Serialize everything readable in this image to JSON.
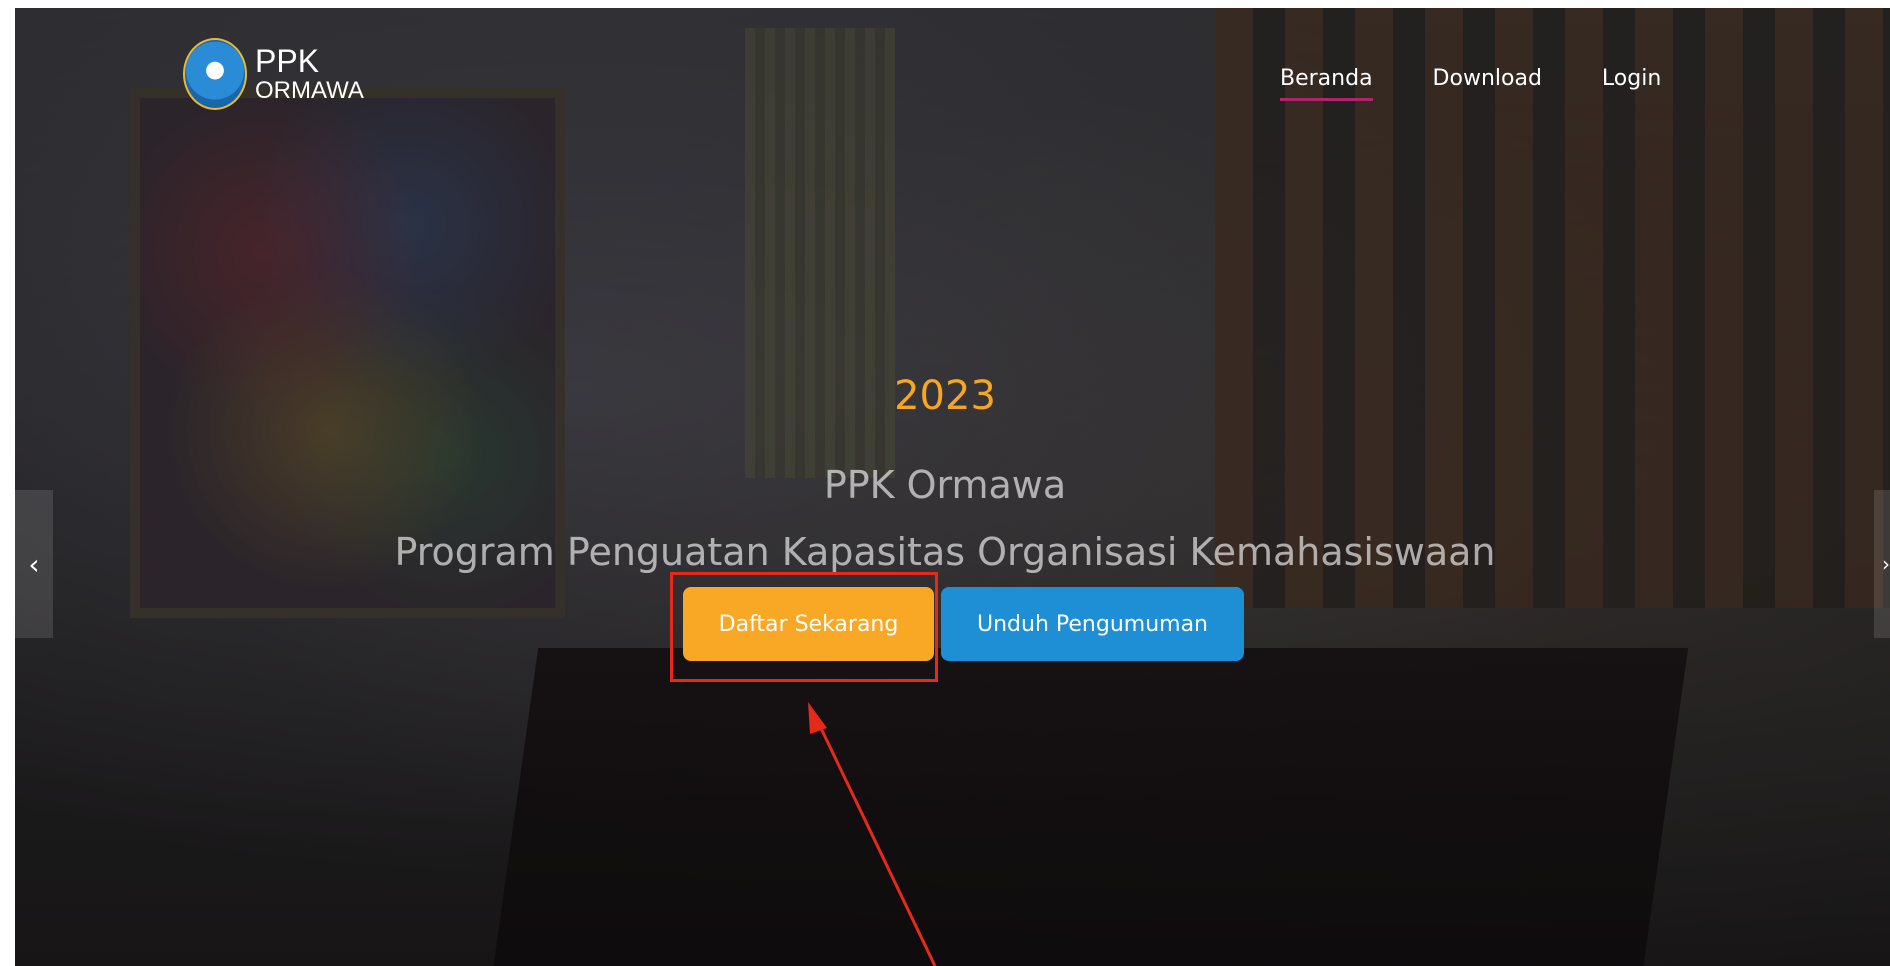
{
  "logo": {
    "title": "PPK",
    "subtitle": "ORMAWA",
    "emblem_icon": "tut-wuri-handayani-emblem-icon"
  },
  "nav": {
    "items": [
      {
        "label": "Beranda",
        "active": true
      },
      {
        "label": "Download",
        "active": false
      },
      {
        "label": "Login",
        "active": false
      }
    ],
    "active_underline_color": "#b0246e"
  },
  "hero": {
    "year": "2023",
    "title": "PPK Ormawa",
    "subtitle": "Program Penguatan Kapasitas Organisasi Kemahasiswaan"
  },
  "buttons": {
    "register_label": "Daftar Sekarang",
    "download_label": "Unduh Pengumuman"
  },
  "carousel": {
    "prev_icon": "chevron-left-icon",
    "next_icon": "chevron-right-icon"
  },
  "colors": {
    "accent_yellow": "#f9a825",
    "accent_blue": "#1e8fd5",
    "year_color": "#f5a623",
    "highlight_red": "#e52a1a"
  }
}
